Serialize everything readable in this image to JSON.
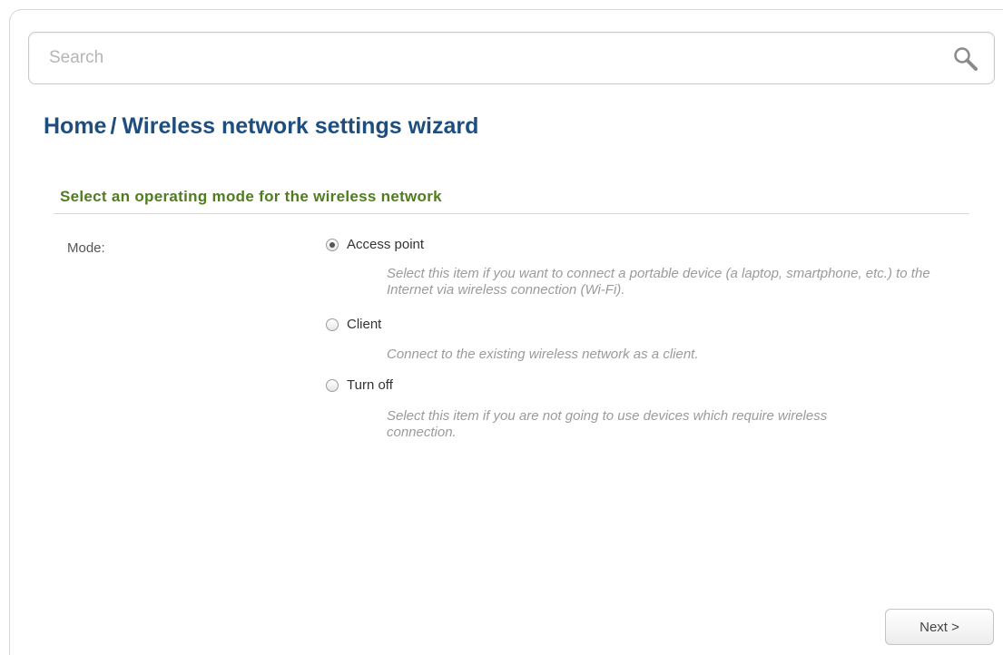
{
  "search": {
    "placeholder": "Search"
  },
  "breadcrumb": {
    "home": "Home",
    "separator": "/",
    "current": "Wireless network settings wizard"
  },
  "section": {
    "title": "Select an operating mode for the wireless network"
  },
  "mode": {
    "label": "Mode:",
    "selected": "Access point",
    "options": [
      {
        "label": "Access point",
        "checked": true,
        "description": "Select this item if you want to connect a portable device (a laptop, smartphone, etc.) to the Internet via wireless connection (Wi-Fi)."
      },
      {
        "label": "Client",
        "checked": false,
        "description": "Connect to the existing wireless network as a client."
      },
      {
        "label": "Turn off",
        "checked": false,
        "description": "Select this item if you are not going to use devices which require wireless connection."
      }
    ]
  },
  "buttons": {
    "next": "Next >"
  },
  "colors": {
    "title": "#1e4e7e",
    "section_title": "#4f7d1d",
    "description": "#9b9b9b"
  }
}
